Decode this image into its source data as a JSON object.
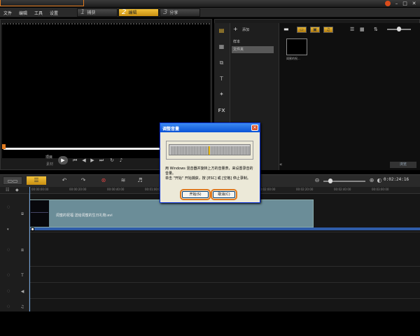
{
  "menu": {
    "items": [
      "文件",
      "编辑",
      "工具",
      "设置"
    ],
    "steps": [
      {
        "num": "1",
        "label": "捕获"
      },
      {
        "num": "2",
        "label": "编辑"
      },
      {
        "num": "3",
        "label": "分享"
      }
    ]
  },
  "preview": {
    "mode_project": "项目",
    "mode_clip": "素材"
  },
  "library": {
    "add_label": "添加",
    "tree_items": [
      "样本",
      "文件夹"
    ],
    "thumb_caption": "闺蜜的祝...",
    "browse_label": "浏览"
  },
  "timeline": {
    "timecode": "0:02:24:16",
    "ruler_ticks": [
      "00:00:00:00",
      "00:00:20:00",
      "00:00:40:00",
      "00:01:00:00",
      "00:01:20:00",
      "00:01:40:00",
      "00:02:00:00",
      "00:02:20:00",
      "00:02:40:00",
      "00:03:00:00"
    ],
    "clip_name": "闺蜜的祝福 送给闺蜜的生日礼物.avi"
  },
  "dialog": {
    "title": "调整音量",
    "message_1": "用 Windows 混音器并旋转上方的音量表，来设置录音的音量。",
    "message_2": "单击 \"开始\" 开始捕获，按 [ESC] 或 [空格] 停止录制。",
    "start_label": "开始(S)",
    "cancel_label": "取消(C)"
  },
  "colors": {
    "accent": "#e07a1f",
    "active_tab": "#f2c23a",
    "clip": "#6b8d98",
    "playhead": "#6fa1d8"
  }
}
